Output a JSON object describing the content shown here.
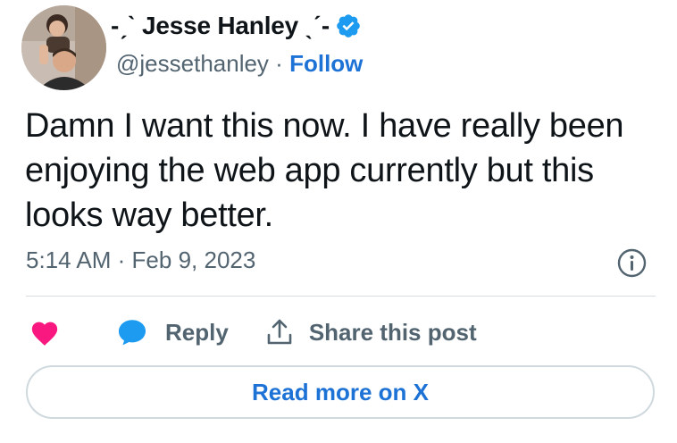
{
  "author": {
    "display_name": "-ˏˋ Jesse Hanley ˎˊ-",
    "handle": "@jessethanley",
    "separator": "·",
    "follow_label": "Follow",
    "verified": true,
    "avatar_icon": "profile-photo"
  },
  "tweet": {
    "text": "Damn I want this now. I have really been enjoying the web app currently but this looks way better.",
    "time": "5:14 AM",
    "date": "Feb 9, 2023",
    "meta_separator": "·"
  },
  "actions": {
    "like_icon": "heart-icon",
    "reply_label": "Reply",
    "share_label": "Share this post"
  },
  "footer": {
    "read_more_label": "Read more on X"
  },
  "colors": {
    "link_blue": "#1d72d6",
    "verified_blue": "#1d9bf0",
    "heart_pink": "#f91880",
    "muted_gray": "#536471",
    "text_dark": "#0f1419",
    "border_gray": "#cfd9de"
  }
}
